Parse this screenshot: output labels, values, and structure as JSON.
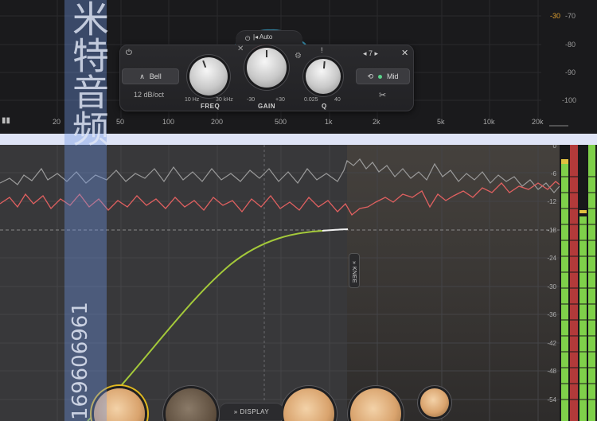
{
  "eq": {
    "db_scale": [
      "-30",
      "-70",
      "-80",
      "-90",
      "-100"
    ],
    "freq_scale": [
      "20",
      "50",
      "100",
      "200",
      "500",
      "1k",
      "2k",
      "5k",
      "10k",
      "20k"
    ],
    "band": {
      "auto_label": "Auto",
      "shape_label": "Bell",
      "slope_label": "12 dB/oct",
      "band_number": "7",
      "stereo_label": "Mid",
      "freq": {
        "name": "FREQ",
        "min": "10 Hz",
        "max": "30 kHz"
      },
      "gain": {
        "name": "GAIN",
        "min": "-30",
        "max": "+30"
      },
      "q": {
        "name": "Q",
        "min": "0.025",
        "max": "40"
      }
    }
  },
  "dynamics": {
    "scale": [
      "0",
      "-6",
      "-12",
      "-18",
      "-24",
      "-30",
      "-36",
      "-42",
      "-48",
      "-54"
    ],
    "knee_label": "KNEE",
    "display_label": "DISPLAY"
  },
  "watermark": {
    "chinese": "米特音频",
    "number": "169606961"
  },
  "colors": {
    "accent_red": "#e23a3a",
    "curve_green": "#a4c93a",
    "analyzer_red": "#e06060",
    "analyzer_gray": "#9a9a9a",
    "knob_orange": "#d9a36d",
    "meter_green": "#7fd04a"
  }
}
